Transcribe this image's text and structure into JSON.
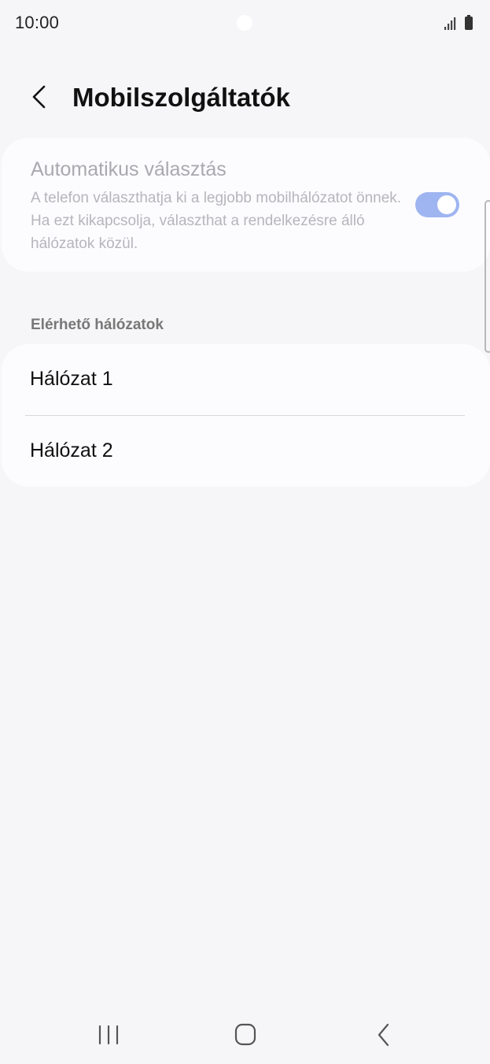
{
  "status_bar": {
    "time": "10:00",
    "icons": [
      "signal-icon",
      "battery-icon"
    ]
  },
  "header": {
    "back_icon": "chevron-left-icon",
    "title": "Mobilszolgáltatók"
  },
  "auto_select": {
    "title": "Automatikus választás",
    "description": "A telefon választhatja ki a legjobb mobilhálózatot önnek. Ha ezt kikapcsolja, választhat a rendelkezésre álló hálózatok közül.",
    "toggle_on": true
  },
  "networks": {
    "section_title": "Elérhető hálózatok",
    "items": [
      {
        "label": "Hálózat 1"
      },
      {
        "label": "Hálózat 2"
      }
    ]
  },
  "nav_bar": {
    "icons": [
      "recent-apps-icon",
      "home-icon",
      "back-icon"
    ]
  },
  "colors": {
    "background": "#f6f6f8",
    "card": "#fcfcff",
    "toggle": "#9fb5f1"
  }
}
